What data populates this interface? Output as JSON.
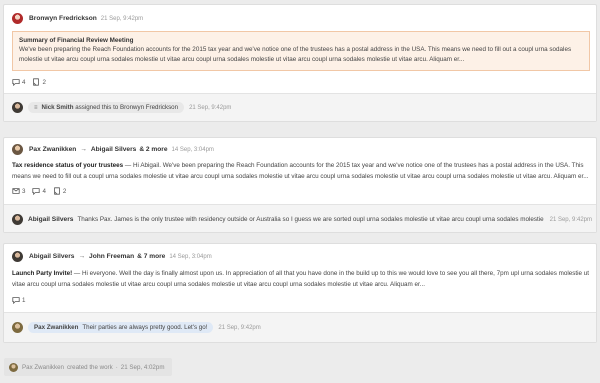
{
  "card1": {
    "author": "Bronwyn Fredrickson",
    "time": "21 Sep, 9:42pm",
    "highlight_title": "Summary of Financial Review Meeting",
    "highlight_body": "We've been preparing the Reach Foundation accounts for the 2015 tax year and we've notice one of the trustees has a postal address in the USA. This means we need to fill out a coupl urna sodales molestie ut vitae arcu coupl urna sodales molestie ut vitae arcu coupl urna sodales molestie ut vitae arcu coupl urna sodales molestie ut vitae arcu. Aliquam er...",
    "comments_count": "4",
    "notes_count": "2",
    "footer_user": "Nick Smith",
    "footer_action": "assigned this to Bronwyn Fredrickson",
    "footer_time": "21 Sep, 9:42pm"
  },
  "card2": {
    "author": "Pax Zwanikken",
    "arrow": "→",
    "recipient": "Abigail Silvers",
    "more": "& 2 more",
    "time": "14 Sep, 3:04pm",
    "subject": "Tax residence status of your trustees",
    "body": " — Hi Abigail. We've been preparing the Reach Foundation accounts for the 2015 tax year and we've notice one of the trustees has a postal address in the USA. This means we need to fill out a coupl urna sodales molestie ut vitae arcu coupl urna sodales molestie ut vitae arcu coupl urna sodales molestie ut vitae arcu coupl urna sodales molestie ut vitae arcu. Aliquam er...",
    "email_count": "3",
    "comments_count": "4",
    "notes_count": "2",
    "reply_user": "Abigail Silvers",
    "reply_text": "Thanks Pax. James is the only trustee with residency outside or Australia so I guess we are sorted oupl urna sodales molestie ut vitae arcu coupl urna sodales molestie ut ...",
    "reply_time": "21 Sep, 9:42pm"
  },
  "card3": {
    "author": "Abigail Silvers",
    "arrow": "→",
    "recipient": "John Freeman",
    "more": "& 7 more",
    "time": "14 Sep, 3:04pm",
    "subject": "Launch Party Invite!",
    "body": " — Hi everyone. Well the day is finally almost upon us. In appreciation of all that you have done in the build up to this we would love to see you all there, 7pm upl urna sodales molestie ut vitae arcu coupl urna sodales molestie ut vitae arcu coupl urna sodales molestie ut vitae arcu coupl urna sodales molestie ut vitae arcu. Aliquam er...",
    "comments_count": "1",
    "reply_user": "Pax Zwanikken",
    "reply_text": "Their parties are always pretty good. Let's go!",
    "reply_time": "21 Sep, 9:42pm"
  },
  "created": {
    "user": "Pax Zwanikken",
    "action": "created the work",
    "separator": "·",
    "time": "21 Sep, 4:02pm"
  },
  "colors": {
    "highlight_bg": "#fdf1e7",
    "highlight_border": "#f1c7a6",
    "reply_pill_blue": "#dfe9f6"
  },
  "icons": [
    "comment-icon",
    "note-icon",
    "email-icon",
    "document-icon"
  ]
}
